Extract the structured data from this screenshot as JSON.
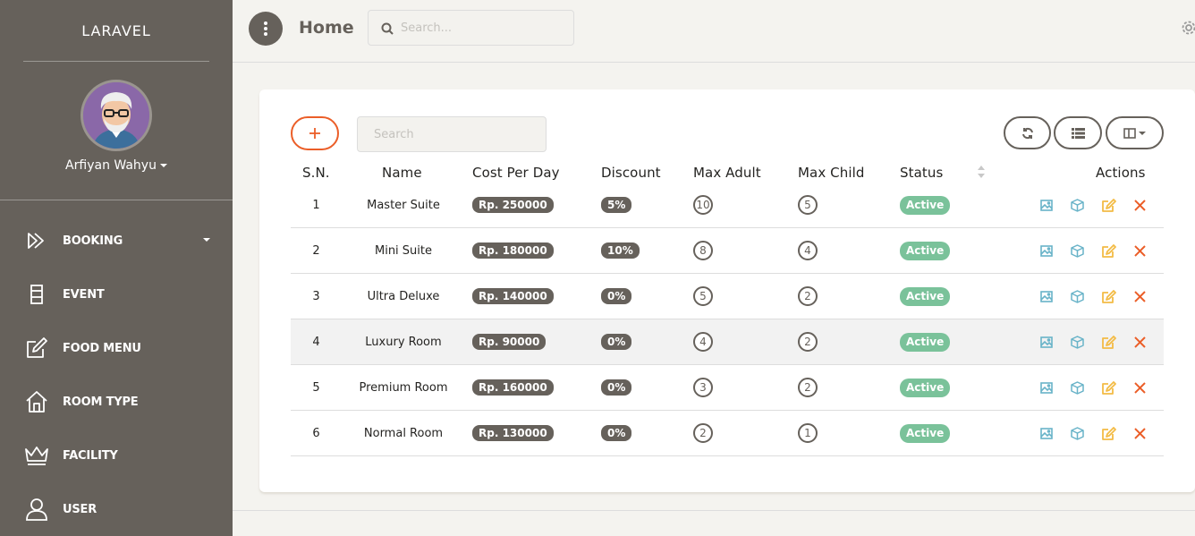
{
  "sidebar": {
    "brand": "LARAVEL",
    "user_name": "Arfiyan Wahyu",
    "items": [
      {
        "label": "BOOKING",
        "icon": "booking-icon"
      },
      {
        "label": "EVENT",
        "icon": "event-icon"
      },
      {
        "label": "FOOD MENU",
        "icon": "edit-icon"
      },
      {
        "label": "ROOM TYPE",
        "icon": "home-icon"
      },
      {
        "label": "FACILITY",
        "icon": "crown-icon"
      },
      {
        "label": "USER",
        "icon": "user-icon"
      }
    ]
  },
  "header": {
    "title": "Home",
    "search_placeholder": "Search..."
  },
  "table": {
    "search_placeholder": "Search",
    "columns": [
      "S.N.",
      "Name",
      "Cost Per Day",
      "Discount",
      "Max Adult",
      "Max Child",
      "Status",
      "Actions"
    ],
    "rows": [
      {
        "sn": "1",
        "name": "Master Suite",
        "cost": "Rp. 250000",
        "discount": "5%",
        "max_adult": "10",
        "max_child": "5",
        "status": "Active"
      },
      {
        "sn": "2",
        "name": "Mini Suite",
        "cost": "Rp. 180000",
        "discount": "10%",
        "max_adult": "8",
        "max_child": "4",
        "status": "Active"
      },
      {
        "sn": "3",
        "name": "Ultra Deluxe",
        "cost": "Rp. 140000",
        "discount": "0%",
        "max_adult": "5",
        "max_child": "2",
        "status": "Active"
      },
      {
        "sn": "4",
        "name": "Luxury Room",
        "cost": "Rp. 90000",
        "discount": "0%",
        "max_adult": "4",
        "max_child": "2",
        "status": "Active"
      },
      {
        "sn": "5",
        "name": "Premium Room",
        "cost": "Rp. 160000",
        "discount": "0%",
        "max_adult": "3",
        "max_child": "2",
        "status": "Active"
      },
      {
        "sn": "6",
        "name": "Normal Room",
        "cost": "Rp. 130000",
        "discount": "0%",
        "max_adult": "2",
        "max_child": "1",
        "status": "Active"
      }
    ],
    "highlighted_row": 3
  },
  "colors": {
    "sidebar_bg": "#66615b",
    "accent_orange": "#eb5e28",
    "status_green": "#7ac29a",
    "action_image": "#68b3c8",
    "action_cube": "#68b3c8",
    "action_edit": "#f3bb45",
    "action_delete": "#eb5e28"
  }
}
